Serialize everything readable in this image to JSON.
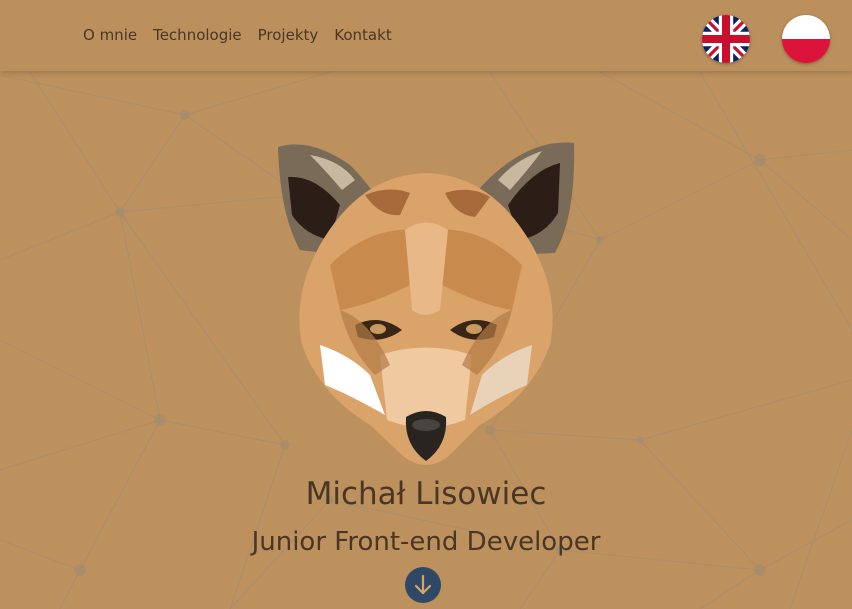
{
  "nav": {
    "links": [
      "O mnie",
      "Technologie",
      "Projekty",
      "Kontakt"
    ]
  },
  "languages": [
    {
      "icon": "uk-flag-icon",
      "code": "en"
    },
    {
      "icon": "pl-flag-icon",
      "code": "pl"
    }
  ],
  "hero": {
    "name": "Michał Lisowiec",
    "role": "Junior Front-end Developer",
    "scroll_icon": "arrow-down-icon",
    "logo_icon": "fox-logo"
  },
  "colors": {
    "background": "#bd915e",
    "text": "#4a3624",
    "accent_button": "#2e4866",
    "network_lines": "#a08a73"
  }
}
